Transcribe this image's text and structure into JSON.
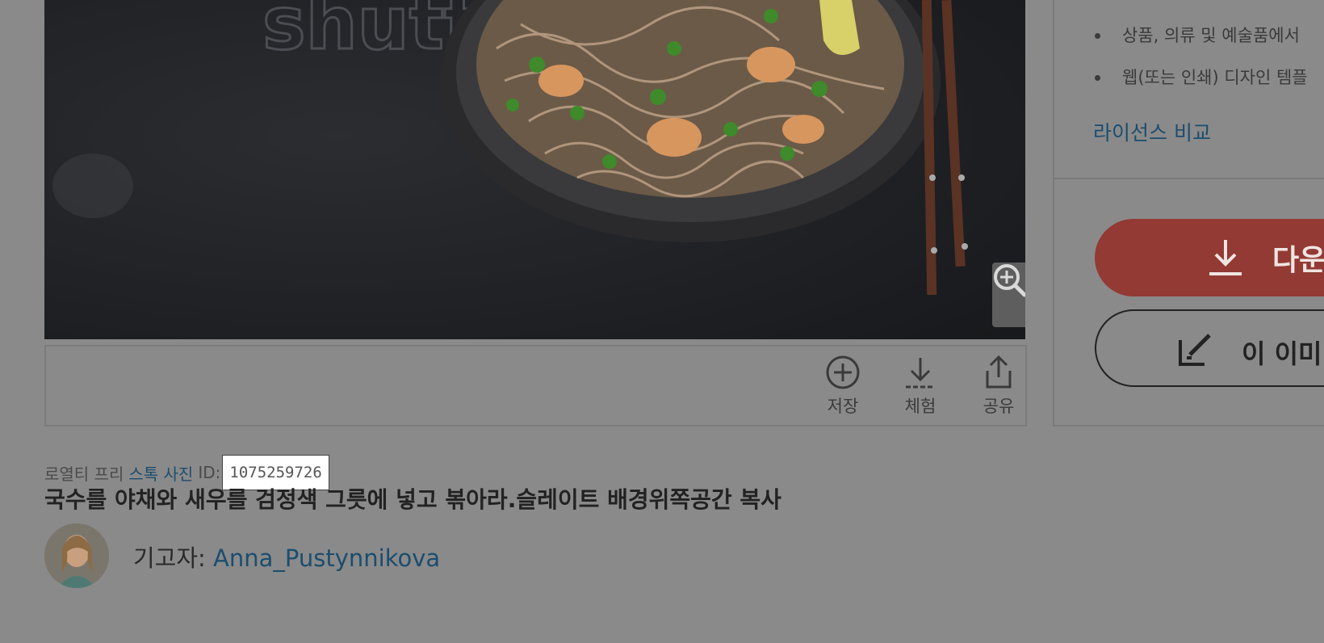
{
  "image": {
    "alt_watermark": "shutterstock"
  },
  "toolbar": {
    "save_label": "저장",
    "try_label": "체험",
    "share_label": "공유"
  },
  "right_panel": {
    "bullets": [
      "상품, 의류 및 예술품에서",
      "웹(또는 인쇄) 디자인 템플"
    ],
    "compare_link": "라이선스 비교",
    "download_label": "다운",
    "edit_label": "이 이미"
  },
  "meta": {
    "prefix": "로열티 프리",
    "category_link": "스톡 사진",
    "id_label": "ID:",
    "id_value": "1075259726"
  },
  "title": "국수를 야채와 새우를 검정색 그릇에 넣고 볶아라.슬레이트 배경위쪽공간 복사",
  "contributor": {
    "label": "기고자:",
    "name": "Anna_Pustynnikova"
  },
  "colors": {
    "overlay_bg": "#8a8a8a",
    "link": "#1c4d6e",
    "download_bg": "#923a33"
  }
}
